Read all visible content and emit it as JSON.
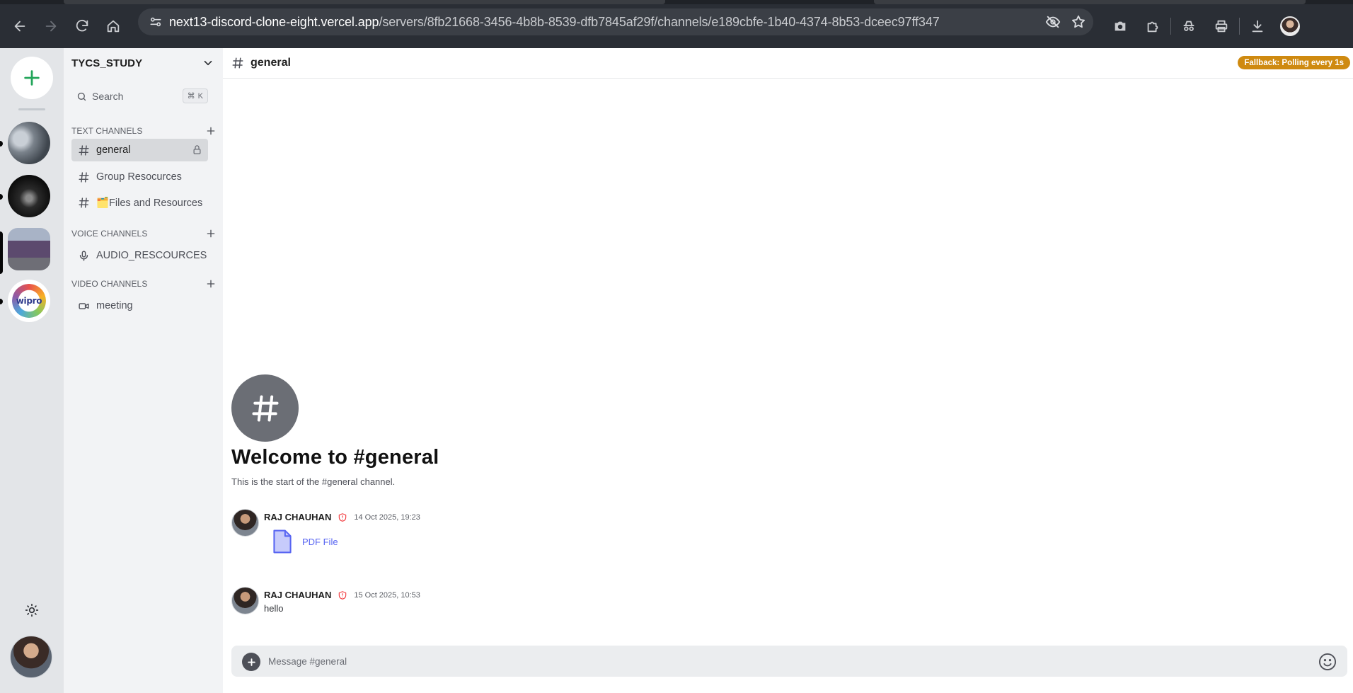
{
  "browser": {
    "url_host": "next13-discord-clone-eight.vercel.app",
    "url_path": "/servers/8fb21668-3456-4b8b-8539-dfb7845af29f/channels/e189cbfe-1b40-4374-8b53-dceec97ff347"
  },
  "server": {
    "name": "TYCS_STUDY",
    "search_label": "Search",
    "search_shortcut": "K"
  },
  "sections": {
    "text": "TEXT CHANNELS",
    "voice": "VOICE CHANNELS",
    "video": "VIDEO CHANNELS"
  },
  "channels": {
    "text": [
      "general",
      "Group Resocurces",
      "🗂️Files and Resources"
    ],
    "voice": [
      "AUDIO_RESCOURCES"
    ],
    "video": [
      "meeting"
    ]
  },
  "chat": {
    "channel_name": "general",
    "fallback_badge": "Fallback: Polling every 1s",
    "welcome_title": "Welcome to #general",
    "welcome_subtitle": "This is the start of the #general channel.",
    "composer_placeholder": "Message #general"
  },
  "messages": [
    {
      "author": "RAJ CHAUHAN",
      "timestamp": "14 Oct 2025, 19:23",
      "attachment_label": "PDF File"
    },
    {
      "author": "RAJ CHAUHAN",
      "timestamp": "15 Oct 2025, 10:53",
      "text": "hello"
    }
  ],
  "colors": {
    "brand_add": "#23a55a",
    "fallback_badge": "#cf8a10",
    "link": "#5865f2",
    "role_icon": "#f23f43"
  }
}
